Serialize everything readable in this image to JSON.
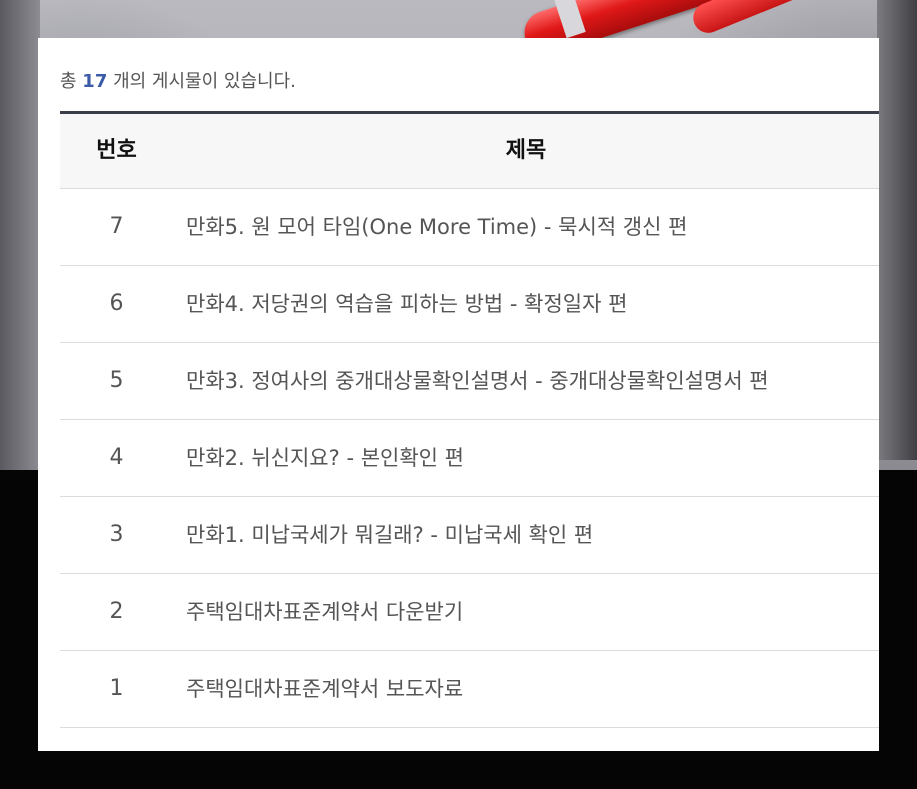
{
  "summary": {
    "prefix": "총",
    "count": "17",
    "suffix": "개의 게시물이 있습니다."
  },
  "table": {
    "headers": {
      "number": "번호",
      "title": "제목"
    },
    "rows": [
      {
        "number": "7",
        "title": "만화5. 원 모어 타임(One More Time) - 묵시적 갱신 편"
      },
      {
        "number": "6",
        "title": "만화4. 저당권의 역습을 피하는 방법 - 확정일자 편"
      },
      {
        "number": "5",
        "title": "만화3. 정여사의 중개대상물확인설명서 - 중개대상물확인설명서 편"
      },
      {
        "number": "4",
        "title": "만화2. 뉘신지요? - 본인확인 편"
      },
      {
        "number": "3",
        "title": "만화1. 미납국세가 뭐길래? - 미납국세 확인 편"
      },
      {
        "number": "2",
        "title": "주택임대차표준계약서 다운받기"
      },
      {
        "number": "1",
        "title": "주택임대차표준계약서 보도자료"
      }
    ]
  },
  "colors": {
    "accent": "#3b5aa8",
    "table_top_border": "#3a3d4a",
    "header_bg": "#f7f7f7",
    "text": "#555555"
  }
}
